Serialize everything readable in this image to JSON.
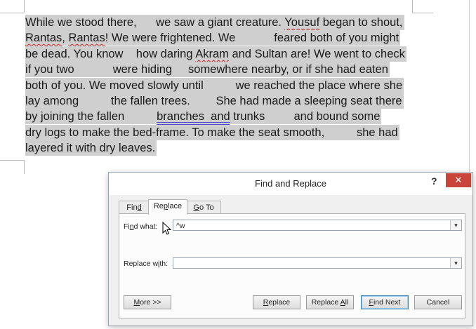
{
  "document": {
    "lines": [
      [
        {
          "t": "While we stood there,      we saw a giant creature. "
        },
        {
          "t": "Yousuf",
          "s": "squig"
        },
        {
          "t": " began to shout,"
        }
      ],
      [
        {
          "t": "Rantas",
          "s": "squig"
        },
        {
          "t": ", "
        },
        {
          "t": "Rantas",
          "s": "squig"
        },
        {
          "t": "! We were frightened. We            feared both of you might"
        }
      ],
      [
        {
          "t": "be dead. You know    how daring "
        },
        {
          "t": "Akram",
          "s": "squig"
        },
        {
          "t": " and Sultan are! We went to check"
        }
      ],
      [
        {
          "t": "if you two            were hiding     somewhere nearby, or if she had eaten"
        }
      ],
      [
        {
          "t": "both of you. We moved slowly until          we reached the place where she"
        }
      ],
      [
        {
          "t": "lay among          the fallen trees.        She had made a sleeping seat there"
        }
      ],
      [
        {
          "t": "by joining the fallen          "
        },
        {
          "t": "branches  and",
          "s": "dbl"
        },
        {
          "t": " trunks         and bound some"
        }
      ],
      [
        {
          "t": "dry logs to make the bed-frame. To make the seat smooth,          she had"
        }
      ],
      [
        {
          "t": "layered it with dry leaves."
        }
      ]
    ]
  },
  "dialog": {
    "title": "Find and Replace",
    "help": "?",
    "close": "✕",
    "tabs": [
      "Find",
      "Replace",
      "Go To"
    ],
    "find_label": "Find what:",
    "find_value": "^w",
    "replace_label": "Replace with:",
    "replace_value": "",
    "dropdown_arrow": "▾",
    "buttons": {
      "more": "More >>",
      "replace": "Replace",
      "replace_all": "Replace All",
      "find_next": "Find Next",
      "cancel": "Cancel"
    }
  }
}
